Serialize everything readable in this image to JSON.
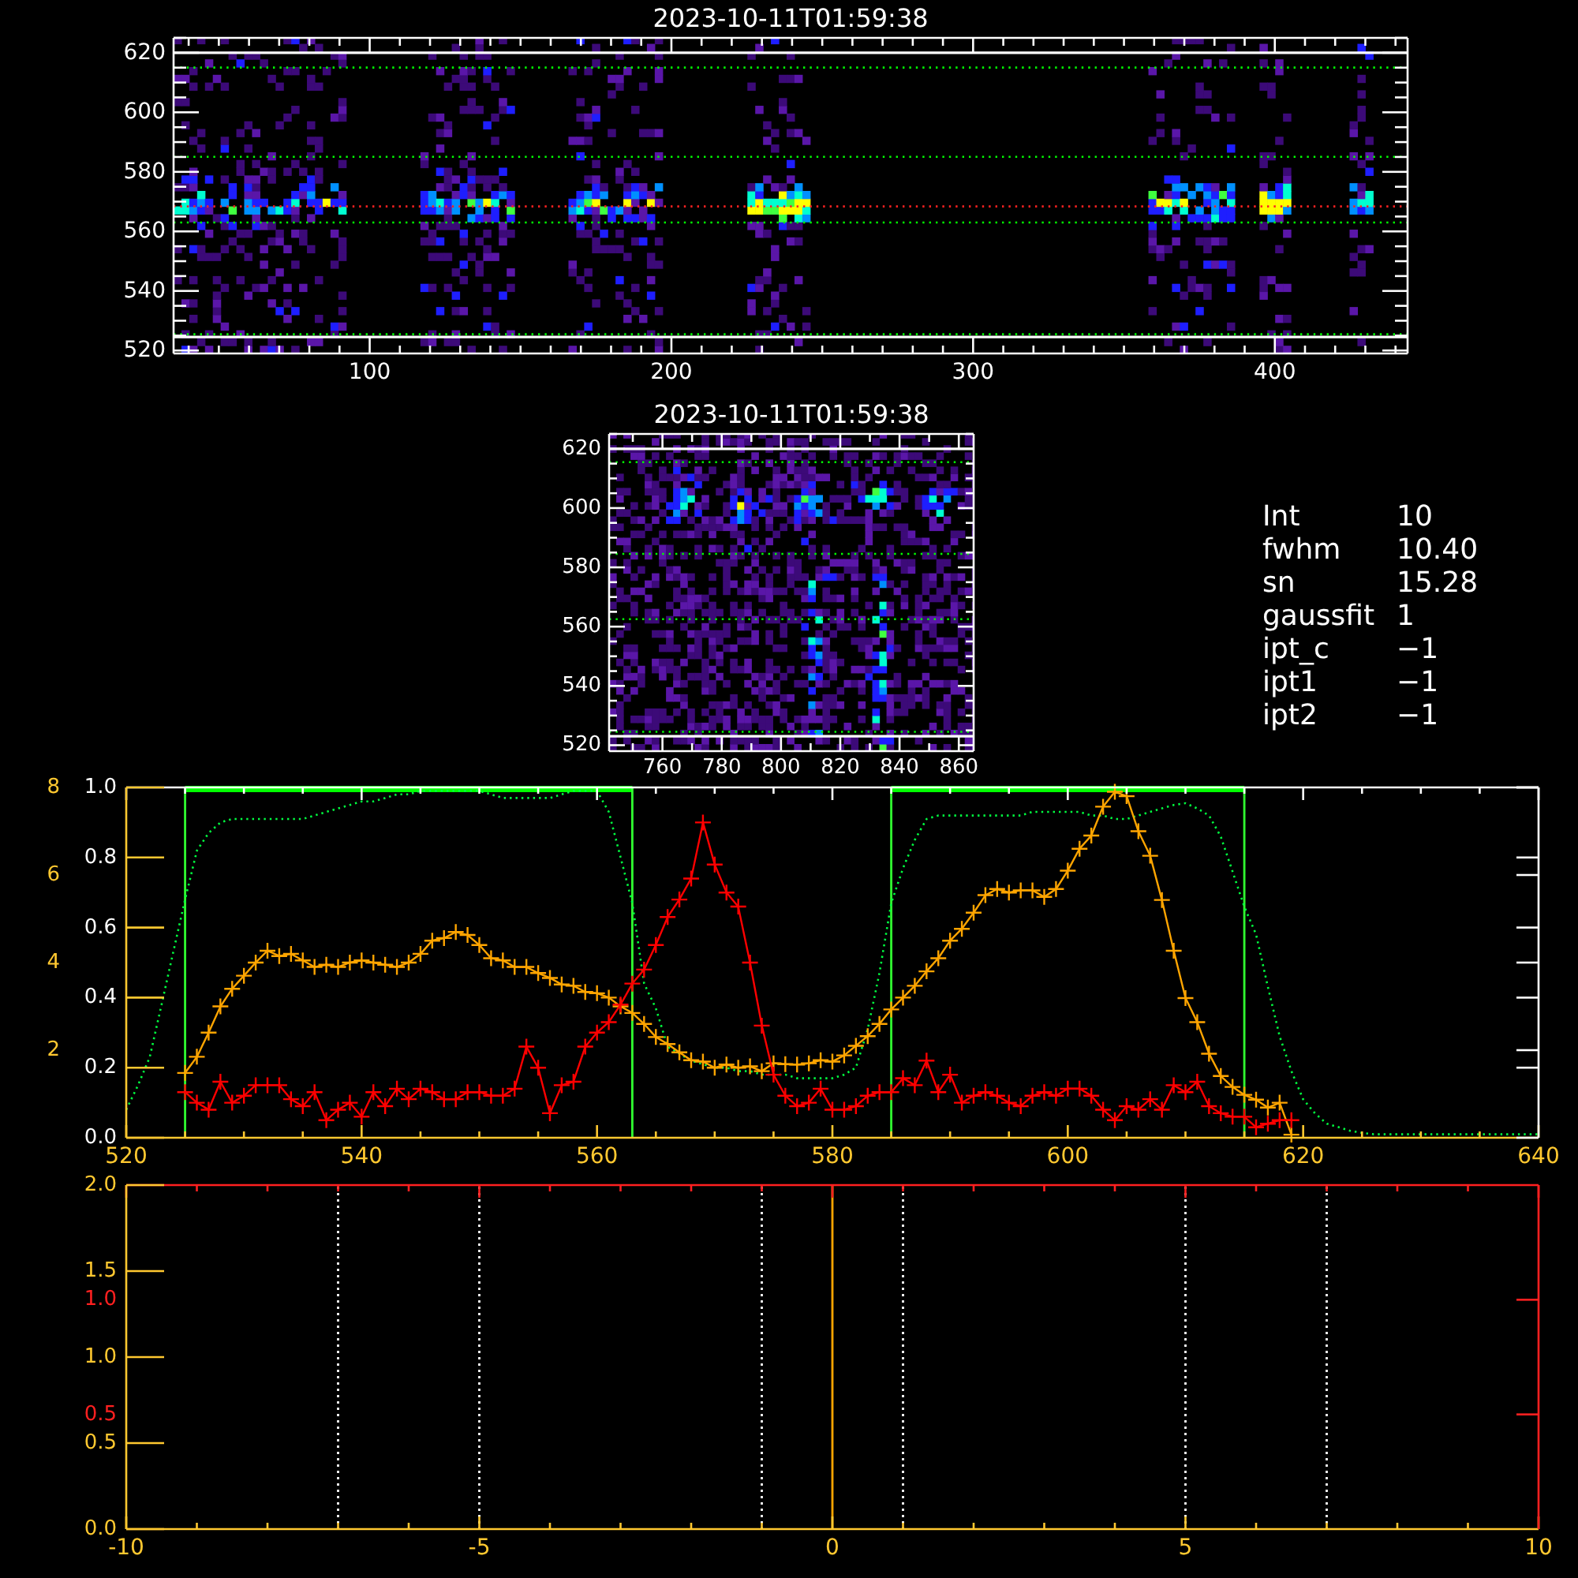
{
  "image_panel": {
    "chart_data": {
      "type": "scatter",
      "title": "2023-10-11T01:59:38",
      "xlim": [
        35,
        444
      ],
      "ylim": [
        519,
        625
      ],
      "xticks": [
        100,
        200,
        300,
        400
      ],
      "yticks": [
        520,
        540,
        560,
        580,
        600,
        620
      ]
    }
  },
  "zoom_image_panel": {
    "chart_data": {
      "type": "scatter",
      "title": "2023-10-11T01:59:38",
      "xlim": [
        742,
        865
      ],
      "ylim": [
        518,
        625
      ],
      "xticks": [
        760,
        780,
        800,
        820,
        840,
        860
      ],
      "yticks": [
        520,
        540,
        560,
        580,
        600,
        620
      ]
    }
  },
  "fit_parameters": [
    {
      "label": "Int",
      "value": "10"
    },
    {
      "label": "fwhm",
      "value": "10.40"
    },
    {
      "label": "sn",
      "value": "15.28"
    },
    {
      "label": "gaussfit",
      "value": "1"
    },
    {
      "label": "ipt_c",
      "value": "−1"
    },
    {
      "label": "ipt1",
      "value": "−1"
    },
    {
      "label": "ipt2",
      "value": "−1"
    }
  ],
  "profile_plot": {
    "chart_data": {
      "type": "line",
      "xlim": [
        520,
        640
      ],
      "ylim": [
        0,
        1
      ],
      "y2lim": [
        0,
        8
      ],
      "xticks": [
        520,
        540,
        560,
        580,
        600,
        620,
        640
      ],
      "yticks": [
        {
          "value": 0,
          "label": "0.0"
        },
        {
          "value": 0.2,
          "label": "0.2"
        },
        {
          "value": 0.4,
          "label": "0.4"
        },
        {
          "value": 0.6,
          "label": "0.6"
        },
        {
          "value": 0.8,
          "label": "0.8"
        },
        {
          "value": 1,
          "label": "1.0"
        }
      ],
      "y2ticks": [
        2,
        4,
        6,
        8
      ],
      "x": [
        520,
        521,
        522,
        523,
        524,
        525,
        526,
        527,
        528,
        529,
        530,
        531,
        532,
        533,
        534,
        535,
        536,
        537,
        538,
        539,
        540,
        541,
        542,
        543,
        544,
        545,
        546,
        547,
        548,
        549,
        550,
        551,
        552,
        553,
        554,
        555,
        556,
        557,
        558,
        559,
        560,
        561,
        562,
        563,
        564,
        565,
        566,
        567,
        568,
        569,
        570,
        571,
        572,
        573,
        574,
        575,
        576,
        577,
        578,
        579,
        580,
        581,
        582,
        583,
        584,
        585,
        586,
        587,
        588,
        589,
        590,
        591,
        592,
        593,
        594,
        595,
        596,
        597,
        598,
        599,
        600,
        601,
        602,
        603,
        604,
        605,
        606,
        607,
        608,
        609,
        610,
        611,
        612,
        613,
        614,
        615,
        616,
        617,
        618,
        619,
        620,
        621,
        622,
        623,
        624,
        625,
        626,
        627,
        628,
        629,
        630,
        631,
        632,
        633,
        634,
        635,
        636,
        637,
        638,
        639,
        640
      ],
      "series": [
        {
          "color": "#00ff40",
          "line_style": "dotted",
          "values": [
            0.08,
            0.15,
            0.23,
            0.38,
            0.53,
            0.68,
            0.82,
            0.87,
            0.9,
            0.91,
            0.91,
            0.91,
            0.91,
            0.91,
            0.91,
            0.91,
            0.92,
            0.93,
            0.94,
            0.95,
            0.96,
            0.96,
            0.97,
            0.98,
            0.98,
            0.99,
            0.99,
            0.99,
            0.99,
            0.99,
            0.99,
            0.98,
            0.97,
            0.97,
            0.97,
            0.97,
            0.97,
            0.98,
            0.99,
            0.99,
            0.99,
            0.93,
            0.8,
            0.67,
            0.44,
            0.37,
            0.26,
            0.24,
            0.22,
            0.21,
            0.2,
            0.2,
            0.19,
            0.19,
            0.18,
            0.18,
            0.18,
            0.17,
            0.17,
            0.17,
            0.17,
            0.18,
            0.2,
            0.31,
            0.47,
            0.67,
            0.77,
            0.85,
            0.91,
            0.92,
            0.92,
            0.92,
            0.92,
            0.92,
            0.92,
            0.92,
            0.92,
            0.93,
            0.93,
            0.93,
            0.93,
            0.93,
            0.92,
            0.92,
            0.91,
            0.91,
            0.92,
            0.93,
            0.94,
            0.95,
            0.955,
            0.94,
            0.92,
            0.86,
            0.76,
            0.66,
            0.58,
            0.43,
            0.29,
            0.19,
            0.11,
            0.07,
            0.04,
            0.03,
            0.02,
            0.014,
            0.01,
            0.01,
            0.01,
            0.01,
            0.01,
            0.01,
            0.01,
            0.01,
            0.01,
            0.01,
            0.01,
            0.01,
            0.01,
            0.01,
            0.01
          ]
        },
        {
          "color": "#ffa500",
          "axis": "y2",
          "marker": "cross",
          "values": [
            null,
            null,
            null,
            null,
            null,
            1.48,
            1.85,
            2.4,
            3.0,
            3.4,
            3.7,
            4.0,
            4.27,
            4.15,
            4.2,
            4.05,
            3.9,
            3.95,
            3.9,
            4.0,
            4.05,
            4.0,
            3.95,
            3.9,
            4.0,
            4.2,
            4.5,
            4.56,
            4.7,
            4.63,
            4.4,
            4.1,
            4.05,
            3.9,
            3.9,
            3.76,
            3.65,
            3.5,
            3.47,
            3.33,
            3.3,
            3.2,
            3.0,
            2.85,
            2.6,
            2.3,
            2.14,
            1.95,
            1.77,
            1.74,
            1.6,
            1.67,
            1.6,
            1.63,
            1.52,
            1.7,
            1.68,
            1.67,
            1.7,
            1.77,
            1.74,
            1.88,
            2.1,
            2.32,
            2.6,
            2.93,
            3.2,
            3.47,
            3.8,
            4.1,
            4.5,
            4.77,
            5.14,
            5.54,
            5.68,
            5.6,
            5.65,
            5.65,
            5.5,
            5.68,
            6.1,
            6.6,
            6.9,
            7.56,
            7.9,
            7.8,
            7.0,
            6.44,
            5.43,
            4.27,
            3.19,
            2.64,
            1.92,
            1.41,
            1.16,
            0.98,
            0.87,
            0.69,
            0.8,
            0.07,
            null,
            null,
            null,
            null,
            null,
            null,
            null,
            null,
            null,
            null,
            null,
            null,
            null,
            null,
            null,
            null,
            null,
            null,
            null,
            null,
            null
          ]
        },
        {
          "color": "#ff0000",
          "marker": "cross",
          "values": [
            null,
            null,
            null,
            null,
            null,
            0.13,
            0.1,
            0.08,
            0.16,
            0.1,
            0.12,
            0.15,
            0.15,
            0.15,
            0.11,
            0.09,
            0.13,
            0.05,
            0.08,
            0.1,
            0.06,
            0.13,
            0.09,
            0.14,
            0.11,
            0.14,
            0.13,
            0.11,
            0.11,
            0.13,
            0.13,
            0.12,
            0.12,
            0.14,
            0.26,
            0.2,
            0.07,
            0.15,
            0.16,
            0.26,
            0.3,
            0.33,
            0.38,
            0.44,
            0.48,
            0.55,
            0.63,
            0.68,
            0.74,
            0.9,
            0.78,
            0.7,
            0.66,
            0.5,
            0.32,
            0.18,
            0.12,
            0.09,
            0.1,
            0.14,
            0.08,
            0.08,
            0.09,
            0.12,
            0.13,
            0.13,
            0.17,
            0.15,
            0.22,
            0.13,
            0.18,
            0.1,
            0.12,
            0.13,
            0.12,
            0.1,
            0.09,
            0.12,
            0.13,
            0.12,
            0.14,
            0.14,
            0.12,
            0.08,
            0.05,
            0.09,
            0.08,
            0.11,
            0.08,
            0.15,
            0.13,
            0.16,
            0.09,
            0.07,
            0.06,
            0.06,
            0.03,
            0.04,
            0.05,
            0.05,
            null,
            null,
            null,
            null,
            null,
            null,
            null,
            null,
            null,
            null,
            null,
            null,
            null,
            null,
            null,
            null,
            null,
            null,
            null,
            null,
            null
          ]
        }
      ],
      "ref_lines": [
        {
          "axis": "x",
          "value": 525
        },
        {
          "axis": "x",
          "value": 563
        },
        {
          "axis": "x",
          "value": 585
        },
        {
          "axis": "x",
          "value": 615
        }
      ]
    }
  },
  "offset_plot": {
    "chart_data": {
      "type": "line",
      "xlim": [
        -10,
        10
      ],
      "ylim": [
        0,
        2
      ],
      "y2lim": [
        0,
        1.5
      ],
      "xticks": [
        -10,
        -5,
        0,
        5,
        10
      ],
      "yticks": [
        {
          "value": 0,
          "label": "0.0"
        },
        {
          "value": 0.5,
          "label": "0.5"
        },
        {
          "value": 1,
          "label": "1.0"
        },
        {
          "value": 1.5,
          "label": "1.5"
        },
        {
          "value": 2,
          "label": "2.0"
        }
      ],
      "y2ticks": [
        {
          "value": 0.5,
          "label": "0.5"
        },
        {
          "value": 1,
          "label": "1.0"
        }
      ],
      "ref_lines": [
        {
          "axis": "x",
          "value": -7,
          "color": "#ffffff"
        },
        {
          "axis": "x",
          "value": -5,
          "color": "#ffffff"
        },
        {
          "axis": "x",
          "value": -1,
          "color": "#ffffff"
        },
        {
          "axis": "x",
          "value": 0,
          "color": "#ffa500"
        },
        {
          "axis": "x",
          "value": 1,
          "color": "#ffffff"
        },
        {
          "axis": "x",
          "value": 5,
          "color": "#ffffff"
        },
        {
          "axis": "x",
          "value": 7,
          "color": "#ffffff"
        }
      ]
    }
  }
}
